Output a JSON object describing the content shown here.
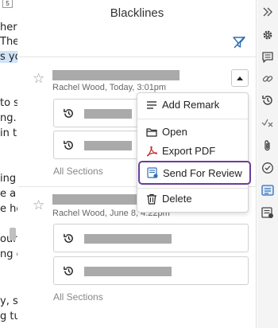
{
  "document": {
    "page_number": "5",
    "fragments": [
      {
        "text": "her a",
        "highlight": false
      },
      {
        "text": "The",
        "highlight": false
      },
      {
        "text": "s yo",
        "highlight": true
      },
      {
        "text": "to s",
        "highlight": false
      },
      {
        "text": "ng. V",
        "highlight": false
      },
      {
        "text": "in t",
        "highlight": false
      },
      {
        "text": "ing",
        "highlight": false
      },
      {
        "text": "e a",
        "highlight": false
      },
      {
        "text": "e he",
        "highlight": false
      },
      {
        "text": "our",
        "highlight": false
      },
      {
        "text": "ng c",
        "highlight": false
      },
      {
        "text": "y, su",
        "highlight": false
      },
      {
        "text": "g tu",
        "highlight": false
      }
    ]
  },
  "panel": {
    "title": "Blacklines",
    "entries": [
      {
        "meta": "Rachel Wood, Today, 3:01pm",
        "sections": "All Sections",
        "versions": 2
      },
      {
        "meta": "Rachel Wood, June 8, 4:22pm",
        "sections": "All Sections",
        "versions": 2
      }
    ]
  },
  "menu": {
    "items": [
      {
        "label": "Add Remark",
        "icon": "lines-icon"
      },
      {
        "label": "Open",
        "icon": "folder-icon"
      },
      {
        "label": "Export PDF",
        "icon": "pdf-icon"
      },
      {
        "label": "Send For Review",
        "icon": "review-icon",
        "selected": true
      },
      {
        "label": "Delete",
        "icon": "trash-icon"
      }
    ]
  },
  "rail": {
    "icons": [
      "expand-icon",
      "gear-icon",
      "comment-icon",
      "link-icon",
      "history-icon",
      "track-changes-icon",
      "attachment-icon",
      "check-circle-icon",
      "blacklines-icon",
      "review-icon"
    ],
    "active": "blacklines-icon"
  },
  "colors": {
    "accent_selection": "#6a3d9a",
    "link_blue": "#2f6fb3",
    "pdf_red": "#c62828"
  }
}
